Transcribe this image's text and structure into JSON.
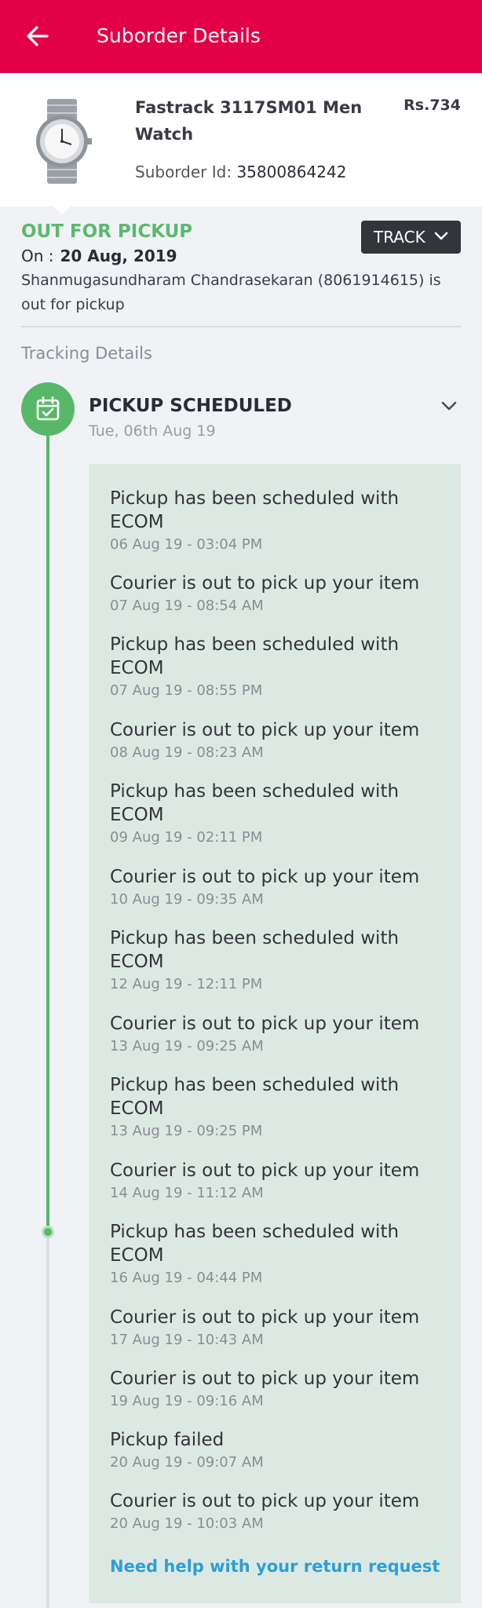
{
  "header": {
    "title": "Suborder Details"
  },
  "product": {
    "name": "Fastrack 3117SM01 Men Watch",
    "price": "Rs.734",
    "suborder_label": "Suborder Id:",
    "suborder_id": "35800864242"
  },
  "status": {
    "title": "OUT FOR PICKUP",
    "on_label": "On :",
    "on_date": "20 Aug, 2019",
    "track_label": "TRACK",
    "message": "Shanmugasundharam Chandrasekaran (8061914615) is out for pickup"
  },
  "tracking": {
    "label": "Tracking Details",
    "milestone_title": "PICKUP SCHEDULED",
    "milestone_date": "Tue, 06th Aug 19",
    "events": [
      {
        "title": "Pickup has been scheduled with ECOM",
        "time": "06 Aug 19 - 03:04 PM"
      },
      {
        "title": "Courier is out to pick up your item",
        "time": "07 Aug 19 - 08:54 AM"
      },
      {
        "title": "Pickup has been scheduled with ECOM",
        "time": "07 Aug 19 - 08:55 PM"
      },
      {
        "title": "Courier is out to pick up your item",
        "time": "08 Aug 19 - 08:23 AM"
      },
      {
        "title": "Pickup has been scheduled with ECOM",
        "time": "09 Aug 19 - 02:11 PM"
      },
      {
        "title": "Courier is out to pick up your item",
        "time": "10 Aug 19 - 09:35 AM"
      },
      {
        "title": "Pickup has been scheduled with ECOM",
        "time": "12 Aug 19 - 12:11 PM"
      },
      {
        "title": "Courier is out to pick up your item",
        "time": "13 Aug 19 - 09:25 AM"
      },
      {
        "title": "Pickup has been scheduled with ECOM",
        "time": "13 Aug 19 - 09:25 PM"
      },
      {
        "title": "Courier is out to pick up your item",
        "time": "14 Aug 19 - 11:12 AM"
      },
      {
        "title": "Pickup has been scheduled with ECOM",
        "time": "16 Aug 19 - 04:44 PM"
      },
      {
        "title": "Courier is out to pick up your item",
        "time": "17 Aug 19 - 10:43 AM"
      },
      {
        "title": "Courier is out to pick up your item",
        "time": "19 Aug 19 - 09:16 AM"
      },
      {
        "title": "Pickup failed",
        "time": "20 Aug 19 - 09:07 AM"
      },
      {
        "title": "Courier is out to pick up your item",
        "time": "20 Aug 19 - 10:03 AM"
      }
    ],
    "help_link": "Need help with your return request"
  },
  "colors": {
    "header_bg": "#e40046",
    "status_green": "#58b86a",
    "events_bg": "#dce9e2",
    "link_blue": "#2c9fd8",
    "track_button_bg": "#33353b"
  },
  "icons": {
    "back": "arrow-left-icon",
    "track_chevron": "chevron-down-icon",
    "milestone": "calendar-check-icon",
    "expand": "chevron-down-icon"
  }
}
